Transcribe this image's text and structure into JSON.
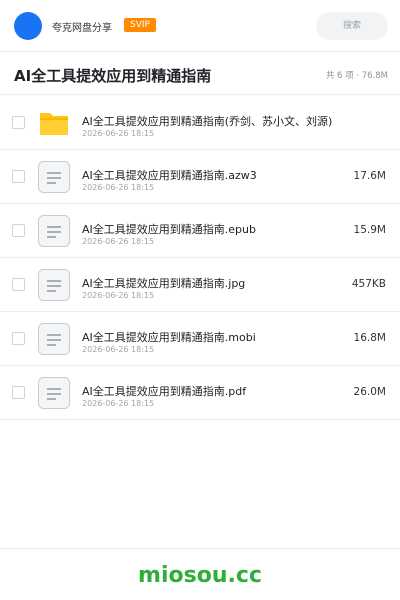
{
  "header": {
    "brand": "夸克网盘分享",
    "badge": "SVIP",
    "search_placeholder": "搜索"
  },
  "titlebar": {
    "title": "AI全工具提效应用到精通指南",
    "summary": "共 6 项 · 76.8M"
  },
  "files": [
    {
      "icon": "folder-icon",
      "name": "AI全工具提效应用到精通指南(乔剑、苏小文、刘源)",
      "date": "2026-06-26 18:15",
      "size": ""
    },
    {
      "icon": "document-icon",
      "name": "AI全工具提效应用到精通指南.azw3",
      "date": "2026-06-26 18:15",
      "size": "17.6M"
    },
    {
      "icon": "document-icon",
      "name": "AI全工具提效应用到精通指南.epub",
      "date": "2026-06-26 18:15",
      "size": "15.9M"
    },
    {
      "icon": "document-icon",
      "name": "AI全工具提效应用到精通指南.jpg",
      "date": "2026-06-26 18:15",
      "size": "457KB"
    },
    {
      "icon": "document-icon",
      "name": "AI全工具提效应用到精通指南.mobi",
      "date": "2026-06-26 18:15",
      "size": "16.8M"
    },
    {
      "icon": "document-icon",
      "name": "AI全工具提效应用到精通指南.pdf",
      "date": "2026-06-26 18:15",
      "size": "26.0M"
    }
  ],
  "footer": {
    "watermark": "miosou.cc"
  },
  "colors": {
    "accent": "#1a73f5",
    "badge": "#ff8a00",
    "watermark": "#2fae3a",
    "folder": "#ffc61a"
  }
}
